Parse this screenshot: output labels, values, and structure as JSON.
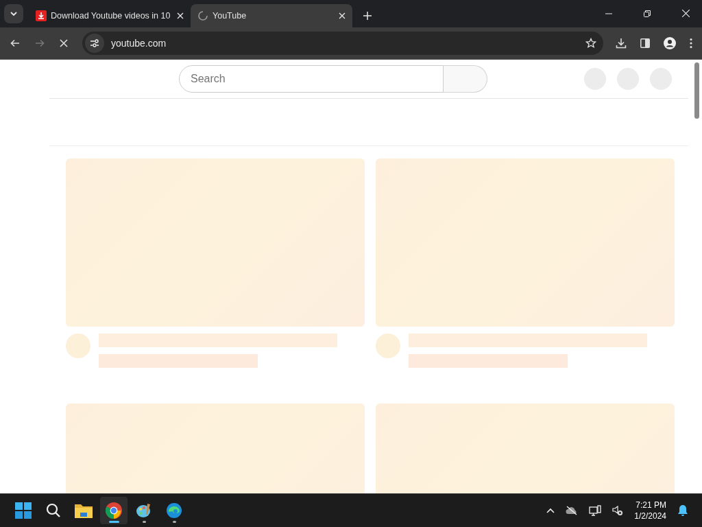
{
  "tabs": [
    {
      "title": "Download Youtube videos in 10",
      "selected": false,
      "kind": "download"
    },
    {
      "title": "YouTube",
      "selected": true,
      "kind": "loading"
    }
  ],
  "address": "youtube.com",
  "search": {
    "placeholder": "Search"
  },
  "taskbar": {
    "apps": [
      {
        "kind": "start",
        "selected": false,
        "running": false
      },
      {
        "kind": "search",
        "selected": false,
        "running": false
      },
      {
        "kind": "folder",
        "selected": false,
        "running": false
      },
      {
        "kind": "chrome",
        "selected": true,
        "running": true
      },
      {
        "kind": "paint",
        "selected": false,
        "running": true
      },
      {
        "kind": "edge",
        "selected": false,
        "running": true
      }
    ],
    "time": "7:21 PM",
    "date": "1/2/2024"
  }
}
